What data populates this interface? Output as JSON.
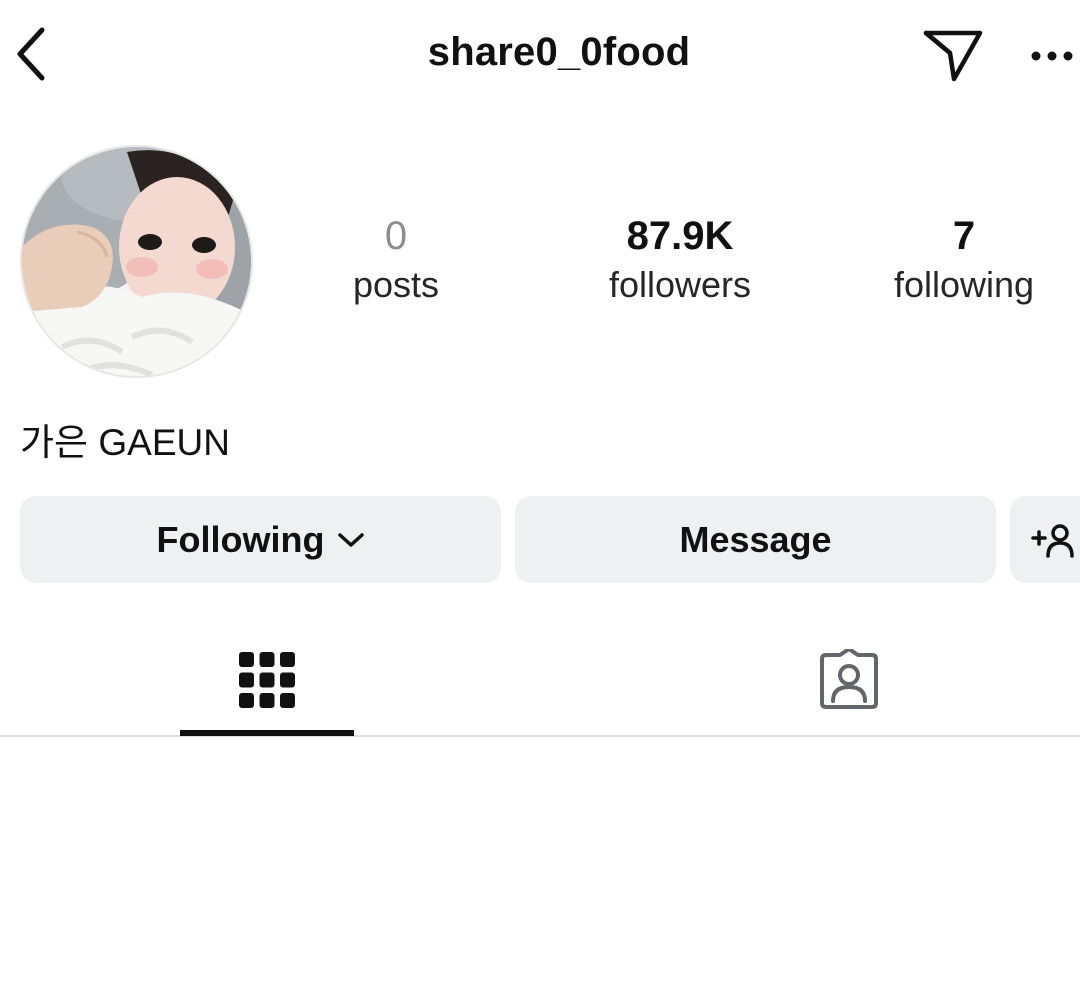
{
  "header": {
    "username": "share0_0food",
    "back_icon": "chevron-left-icon",
    "direct_icon": "paper-plane-icon",
    "more_icon": "ellipsis-icon"
  },
  "profile": {
    "display_name": "가은 GAEUN",
    "stats": {
      "posts": {
        "value": "0",
        "label": "posts"
      },
      "followers": {
        "value": "87.9K",
        "label": "followers"
      },
      "following": {
        "value": "7",
        "label": "following"
      }
    }
  },
  "actions": {
    "following_label": "Following",
    "message_label": "Message",
    "add_user_icon": "add-user-icon"
  },
  "tabs": {
    "active": "grid",
    "items": [
      "grid-icon",
      "tagged-icon"
    ]
  },
  "colors": {
    "button_bg": "#eff0f2",
    "text": "#111111",
    "muted": "#8e8e8e",
    "divider": "#dbdbdb"
  }
}
